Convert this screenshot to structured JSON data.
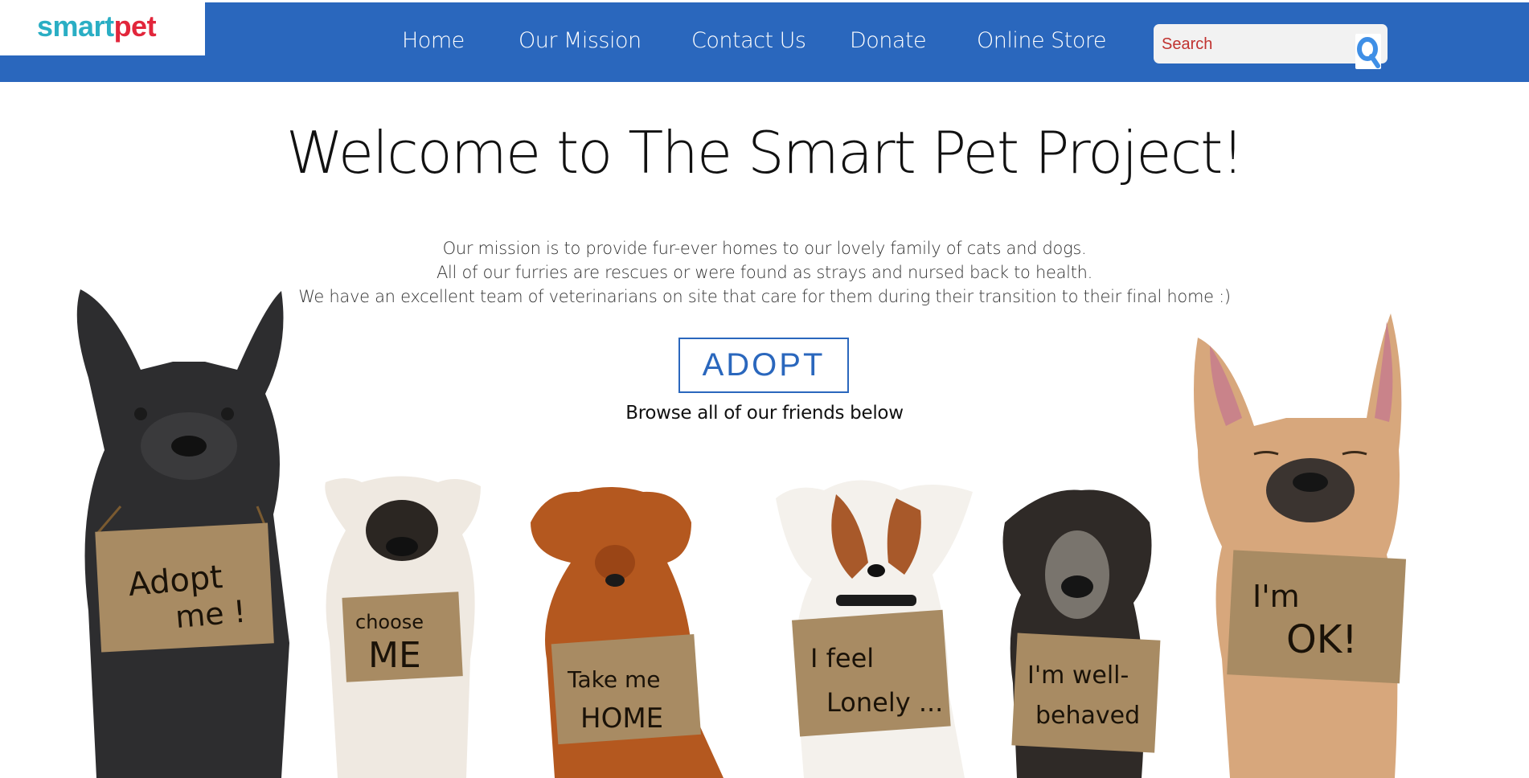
{
  "header": {
    "logo": {
      "part1": "smart",
      "part2": "pet"
    },
    "nav": [
      {
        "label": "Home"
      },
      {
        "label": "Our Mission"
      },
      {
        "label": "Contact Us"
      },
      {
        "label": "Donate"
      },
      {
        "label": "Online Store"
      }
    ],
    "search": {
      "placeholder": "Search",
      "value": "",
      "icon": "search-icon"
    }
  },
  "main": {
    "title": "Welcome to The Smart Pet Project!",
    "mission_lines": [
      "Our mission is to provide fur-ever homes to our lovely family of cats and dogs.",
      "All of our furries are rescues or were found as strays and nursed back to health.",
      "We have an excellent team of veterinarians on site that care for them during their transition to their final home :)"
    ],
    "adopt_label": "ADOPT",
    "browse_text": "Browse all of our friends below"
  },
  "hero_image": {
    "signs": [
      {
        "line1": "Adopt",
        "line2": "me !"
      },
      {
        "line1": "choose",
        "line2": "ME"
      },
      {
        "line1": "Take me",
        "line2": "HOME"
      },
      {
        "line1": "I feel",
        "line2": "Lonely ..."
      },
      {
        "line1": "I'm well-",
        "line2": "behaved"
      },
      {
        "line1": "I'm",
        "line2": "OK!"
      }
    ]
  },
  "colors": {
    "nav_bg": "#2a67bd",
    "logo_smart": "#2aaec4",
    "logo_pet": "#e2263b",
    "accent": "#2a67bd",
    "search_text": "#c0322f"
  }
}
